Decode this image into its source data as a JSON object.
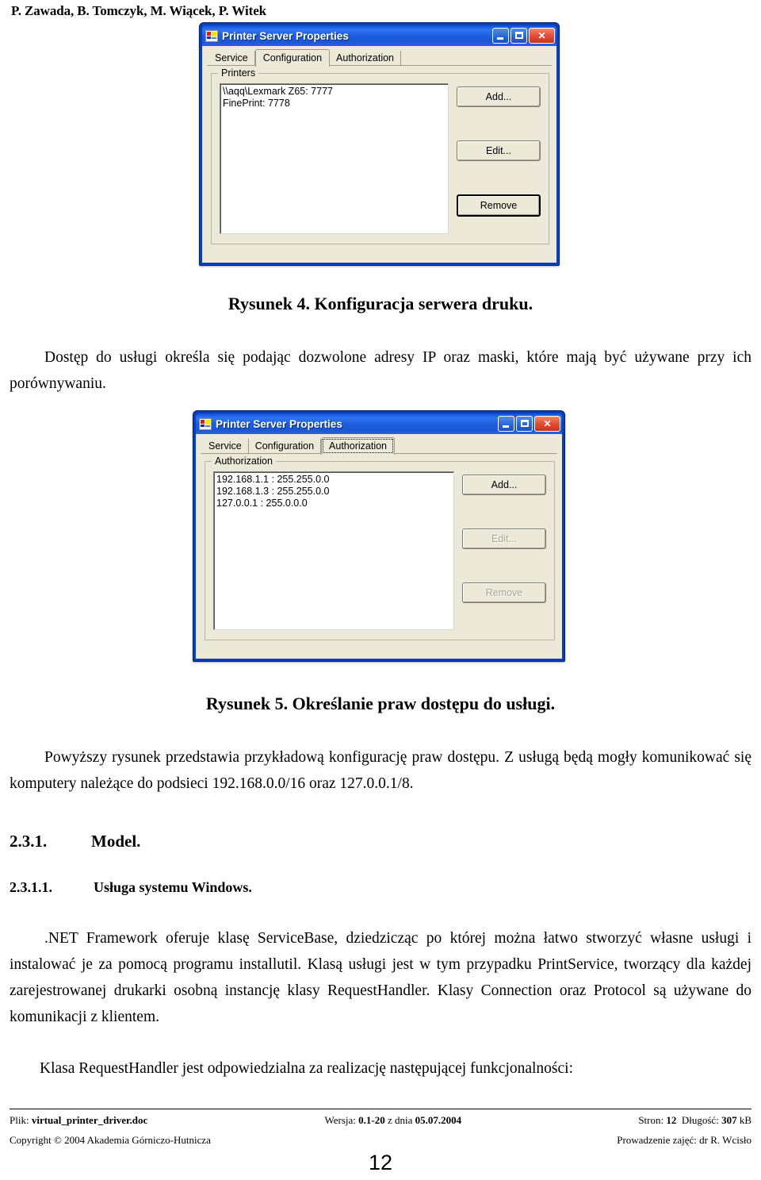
{
  "header": {
    "authors": "P. Zawada, B. Tomczyk, M. Wiącek, P. Witek"
  },
  "dialog1": {
    "title": "Printer Server Properties",
    "icon": "printer-server-icon",
    "window_buttons": {
      "minimize": "minimize-icon",
      "maximize": "maximize-icon",
      "close": "close-icon"
    },
    "tabs": [
      {
        "label": "Service",
        "selected": false
      },
      {
        "label": "Configuration",
        "selected": true
      },
      {
        "label": "Authorization",
        "selected": false
      }
    ],
    "group_legend": "Printers",
    "list_items": [
      "\\\\aqq\\Lexmark Z65: 7777",
      "FinePrint: 7778"
    ],
    "buttons": [
      {
        "label": "Add...",
        "state": "enabled"
      },
      {
        "label": "Edit...",
        "state": "enabled"
      },
      {
        "label": "Remove",
        "state": "default"
      }
    ]
  },
  "dialog2": {
    "title": "Printer Server Properties",
    "icon": "printer-server-icon",
    "window_buttons": {
      "minimize": "minimize-icon",
      "maximize": "maximize-icon",
      "close": "close-icon"
    },
    "tabs": [
      {
        "label": "Service",
        "selected": false
      },
      {
        "label": "Configuration",
        "selected": false
      },
      {
        "label": "Authorization",
        "selected": true
      }
    ],
    "group_legend": "Authorization",
    "list_items": [
      "192.168.1.1 : 255.255.0.0",
      "192.168.1.3 : 255.255.0.0",
      "127.0.0.1 : 255.0.0.0"
    ],
    "buttons": [
      {
        "label": "Add...",
        "state": "enabled"
      },
      {
        "label": "Edit...",
        "state": "disabled"
      },
      {
        "label": "Remove",
        "state": "disabled"
      }
    ]
  },
  "body": {
    "caption_fig4": "Rysunek 4. Konfiguracja serwera druku.",
    "para1": "Dostęp do usługi określa się podając dozwolone adresy IP oraz maski, które mają być używane przy ich porównywaniu.",
    "caption_fig5": "Rysunek 5. Określanie praw dostępu do usługi.",
    "para2": "Powyższy rysunek przedstawia przykładową konfigurację praw dostępu. Z usługą będą mogły komunikować się komputery należące do podsieci 192.168.0.0/16 oraz 127.0.0.1/8.",
    "heading_231_num": "2.3.1.",
    "heading_231_text": "Model.",
    "heading_2311_num": "2.3.1.1.",
    "heading_2311_text": "Usługa systemu Windows.",
    "para3": ".NET Framework oferuje klasę ServiceBase, dziedzicząc po której można łatwo stworzyć własne usługi i instalować je za pomocą programu installutil. Klasą usługi jest w tym przypadku PrintService, tworzący dla każdej zarejestrowanej drukarki osobną instancję klasy RequestHandler. Klasy Connection oraz Protocol są używane do komunikacji z klientem.",
    "para4": "Klasa RequestHandler jest odpowiedzialna za realizację następującej funkcjonalności:"
  },
  "footer": {
    "file_label": "Plik:",
    "file_name": "virtual_printer_driver.doc",
    "version_label": "Wersja:",
    "version_value": "0.1-20",
    "version_mid": "z dnia",
    "version_date": "05.07.2004",
    "pages_label": "Stron:",
    "pages_value": "12",
    "size_label": "Długość:",
    "size_value": "307",
    "size_unit": "kB",
    "copyright": "Copyright © 2004 Akademia Górniczo-Hutnicza",
    "instructor": "Prowadzenie zajęć: dr R. Wcisło",
    "page_number": "12"
  }
}
